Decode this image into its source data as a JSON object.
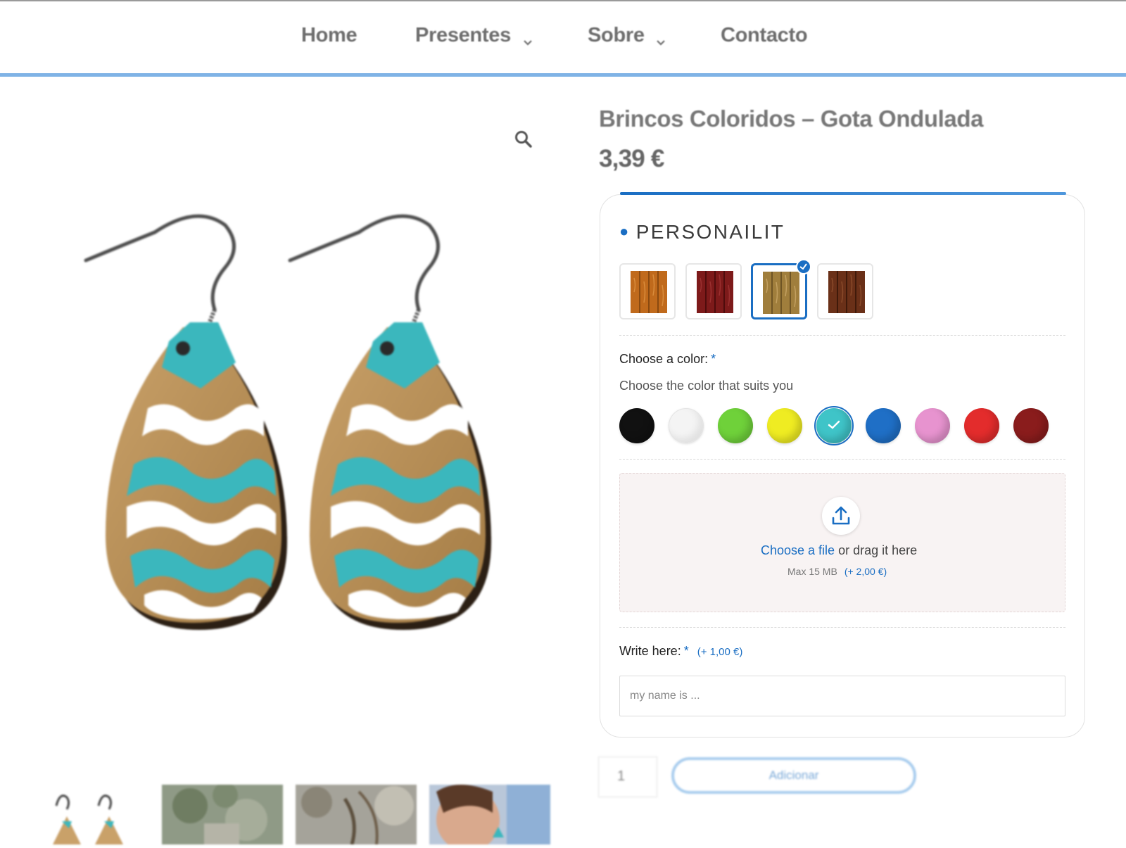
{
  "nav": {
    "items": [
      {
        "label": "Home",
        "has_dropdown": false
      },
      {
        "label": "Presentes",
        "has_dropdown": true
      },
      {
        "label": "Sobre",
        "has_dropdown": true
      },
      {
        "label": "Contacto",
        "has_dropdown": false
      }
    ]
  },
  "product": {
    "title": "Brincos Coloridos – Gota Ondulada",
    "price": "3,39 €",
    "image_icon": "teardrop-earrings-image",
    "thumbnails": [
      "earrings-thumbnail",
      "garden-photo-thumbnail",
      "outdoor-photo-thumbnail",
      "model-wearing-earrings-thumbnail"
    ]
  },
  "personalize": {
    "title": "PERSONAILIT",
    "wood_options": [
      {
        "color": "#c06a1c",
        "selected": false
      },
      {
        "color": "#7d1a1a",
        "selected": false
      },
      {
        "color": "#a07e3c",
        "selected": true
      },
      {
        "color": "#6a3018",
        "selected": false
      }
    ],
    "color_label": "Choose a color:",
    "required_mark": "*",
    "color_subtext": "Choose the color that suits you",
    "colors": [
      {
        "name": "black",
        "hex": "#111111",
        "selected": false
      },
      {
        "name": "white",
        "hex": "#f4f4f4",
        "selected": false
      },
      {
        "name": "green",
        "hex": "#6fd13a",
        "selected": false
      },
      {
        "name": "yellow",
        "hex": "#efec22",
        "selected": false
      },
      {
        "name": "turquoise",
        "hex": "#3fc4c8",
        "selected": true
      },
      {
        "name": "blue",
        "hex": "#1f6fc6",
        "selected": false
      },
      {
        "name": "pink",
        "hex": "#e793cf",
        "selected": false
      },
      {
        "name": "red",
        "hex": "#e32c2c",
        "selected": false
      },
      {
        "name": "dark-red",
        "hex": "#8a1c1c",
        "selected": false
      }
    ],
    "upload": {
      "link_text": "Choose a file",
      "rest_text": " or drag it here",
      "max_size": "Max 15 MB",
      "extra_price": "(+ 2,00 €)"
    },
    "write_label": "Write here:",
    "write_extra_price": "(+ 1,00 €)",
    "write_placeholder": "my name is ..."
  },
  "cart": {
    "quantity": "1",
    "add_label": "Adicionar"
  },
  "accent": "#1a6ec3"
}
